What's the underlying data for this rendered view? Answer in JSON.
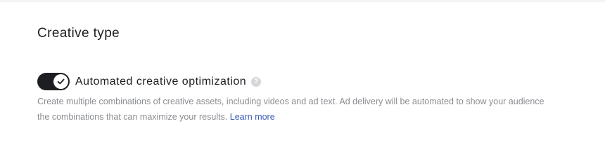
{
  "section": {
    "title": "Creative type"
  },
  "toggle": {
    "label": "Automated creative optimization",
    "enabled": true,
    "help_icon": "question-mark-icon",
    "check_icon": "checkmark-icon"
  },
  "description": {
    "text": "Create multiple combinations of creative assets, including videos and ad text. Ad delivery will be automated to show your audience the combinations that can maximize your results.",
    "link_label": "Learn more"
  },
  "colors": {
    "toggle_on": "#1c1e21",
    "link": "#3b5ab7",
    "muted_text": "#8a8d91"
  }
}
